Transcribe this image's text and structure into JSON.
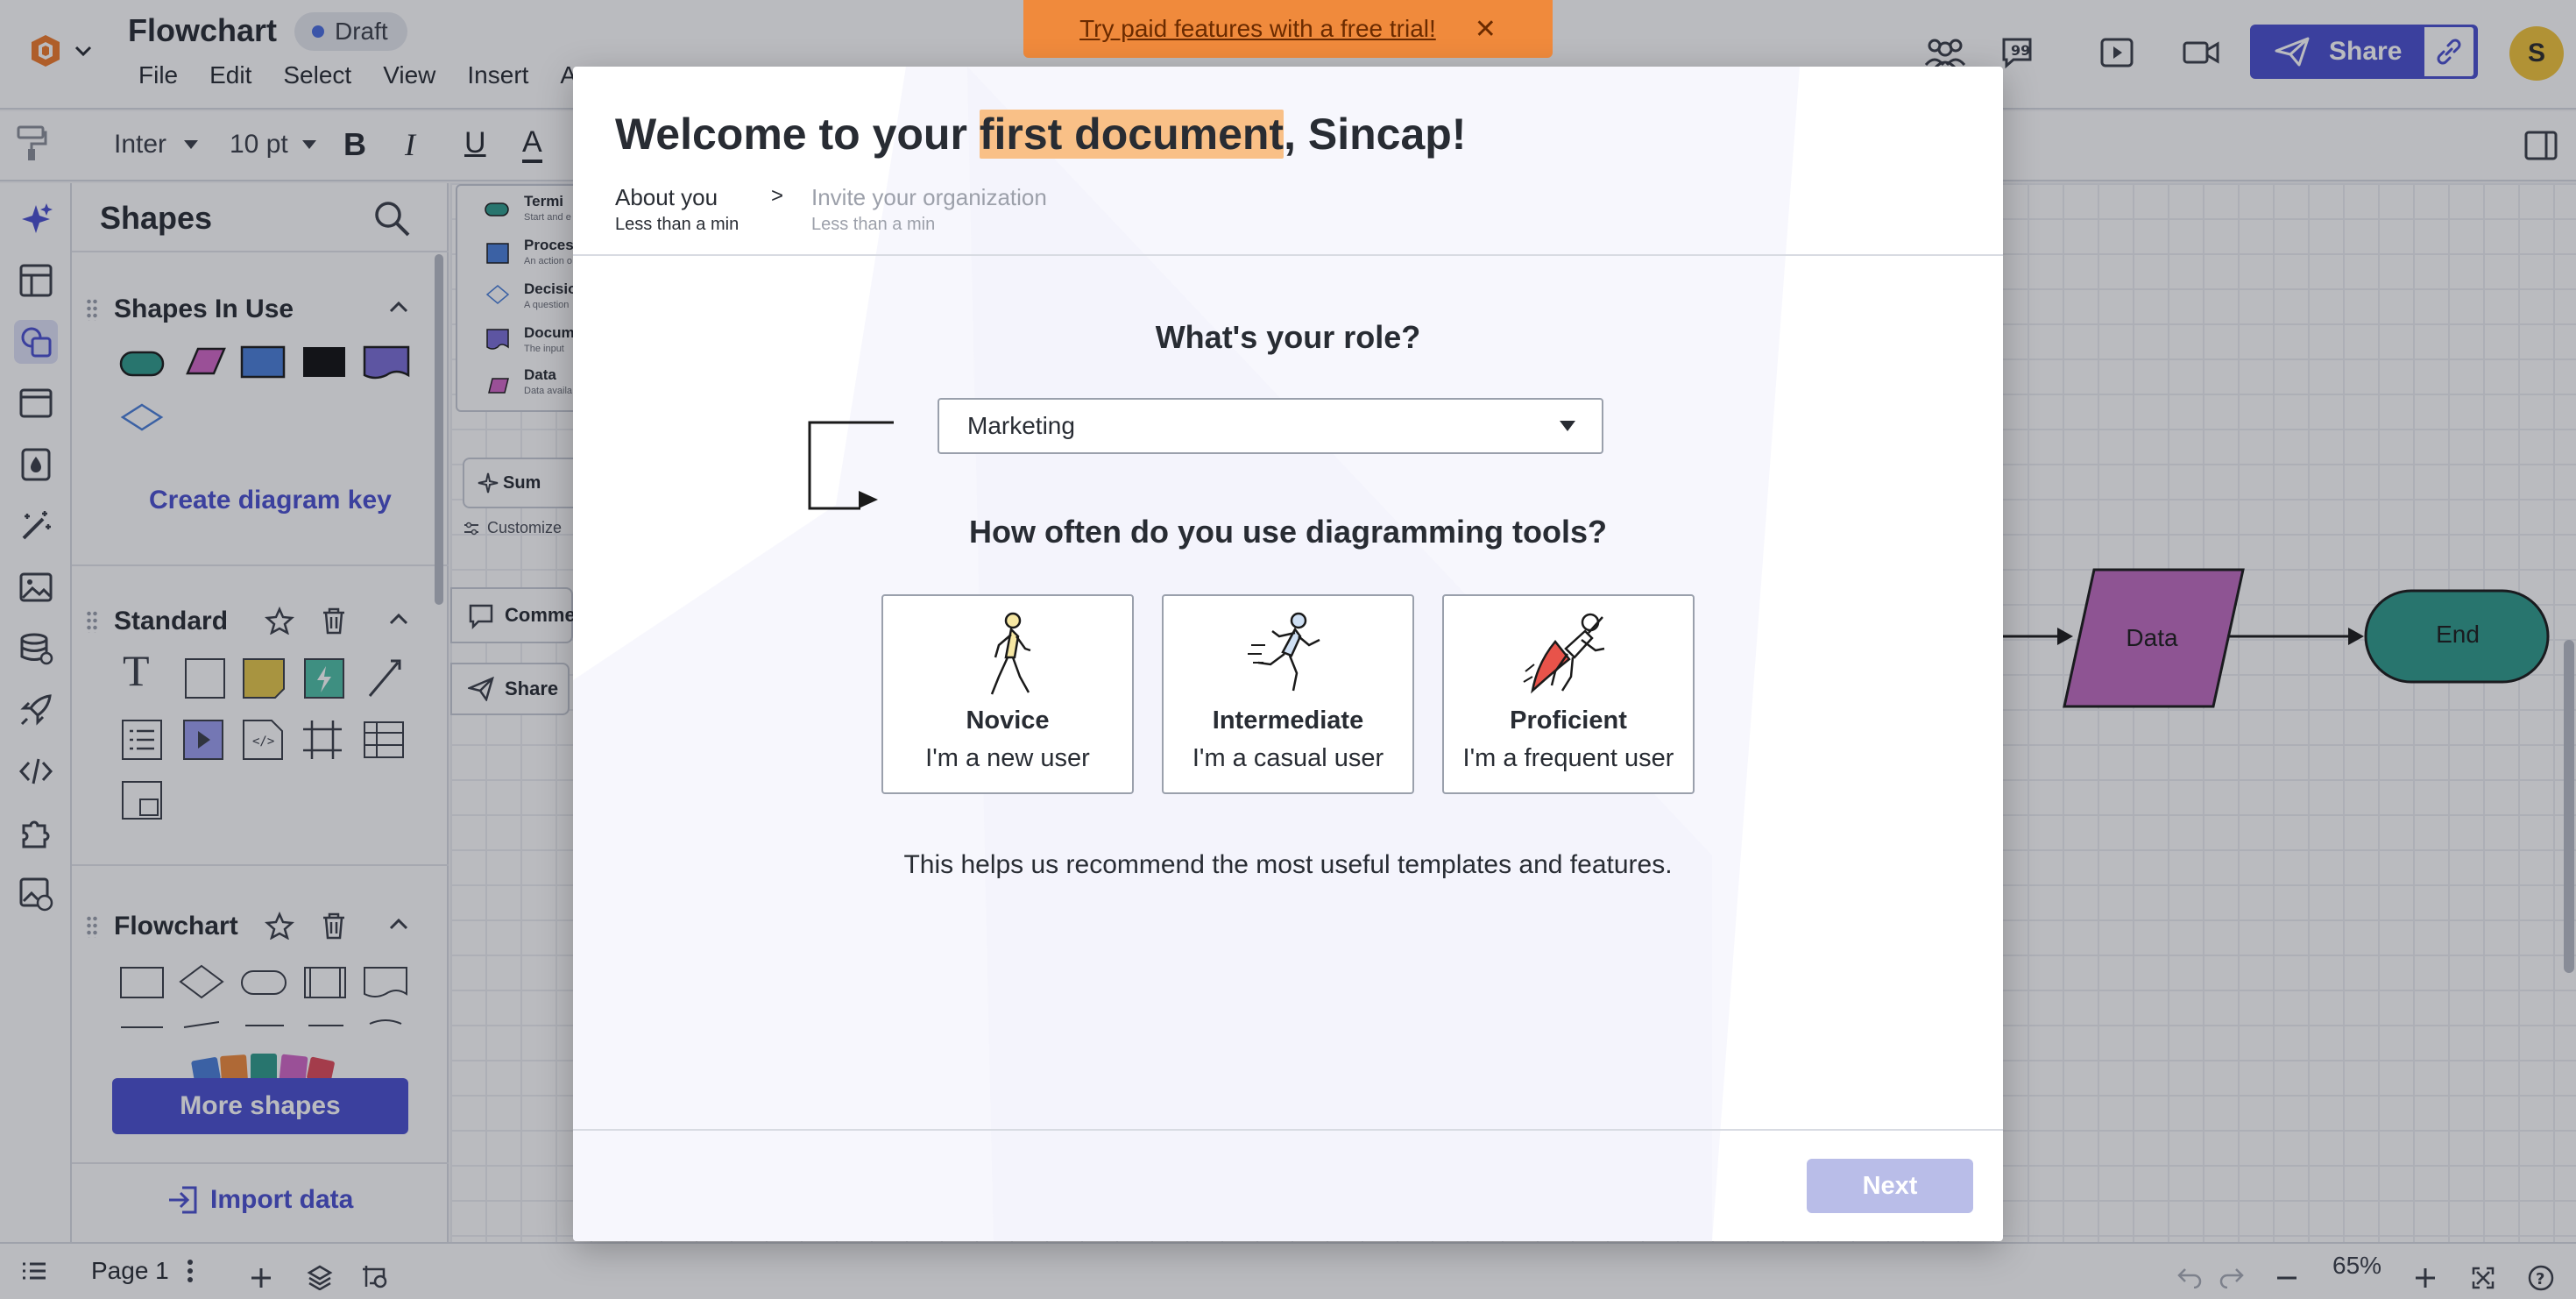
{
  "app": {
    "doc_title": "Flowchart",
    "status_badge": "Draft",
    "menu": [
      "File",
      "Edit",
      "Select",
      "View",
      "Insert",
      "Ar"
    ],
    "trial_banner": "Try paid features with a free trial!",
    "share_label": "Share",
    "avatar_initial": "S",
    "accent_color": "#4a4fd0",
    "banner_color": "#f08a3c"
  },
  "toolbar": {
    "font": "Inter",
    "font_size": "10 pt",
    "bold": "B",
    "italic": "I",
    "underline": "U",
    "font_color": "A"
  },
  "shapes_panel": {
    "title": "Shapes",
    "sections": {
      "in_use": "Shapes In Use",
      "standard": "Standard",
      "flowchart": "Flowchart"
    },
    "create_key": "Create diagram key",
    "more_shapes": "More shapes",
    "import_data": "Import data"
  },
  "canvas": {
    "key_items": [
      {
        "label": "Termi",
        "sub": "Start and e"
      },
      {
        "label": "Proces",
        "sub": "An action o"
      },
      {
        "label": "Decisio",
        "sub": "A question"
      },
      {
        "label": "Docum",
        "sub": "The input"
      },
      {
        "label": "Data",
        "sub": "Data availa"
      }
    ],
    "summarize_label": "Sum",
    "customize_label": "Customize",
    "comment_label": "Commen",
    "share_label": "Share",
    "data_node": "Data",
    "end_node": "End"
  },
  "bottom": {
    "page_label": "Page 1",
    "zoom": "65%"
  },
  "modal": {
    "heading_prefix": "Welcome to your ",
    "heading_highlight": "first document",
    "heading_suffix": ", Sincap!",
    "steps": [
      {
        "label": "About you",
        "sub": "Less than a min"
      },
      {
        "label": "Invite your organization",
        "sub": "Less than a min"
      }
    ],
    "step_separator": ">",
    "role_question": "What's your role?",
    "role_value": "Marketing",
    "frequency_question": "How often do you use diagramming tools?",
    "options": [
      {
        "title": "Novice",
        "desc": "I'm a new user",
        "icon": "walking-person-icon"
      },
      {
        "title": "Intermediate",
        "desc": "I'm a casual user",
        "icon": "running-person-icon"
      },
      {
        "title": "Proficient",
        "desc": "I'm a frequent user",
        "icon": "superhero-flying-icon"
      }
    ],
    "helper_text": "This helps us recommend the most useful templates and features.",
    "next_label": "Next",
    "highlight_color": "#f9c087"
  }
}
